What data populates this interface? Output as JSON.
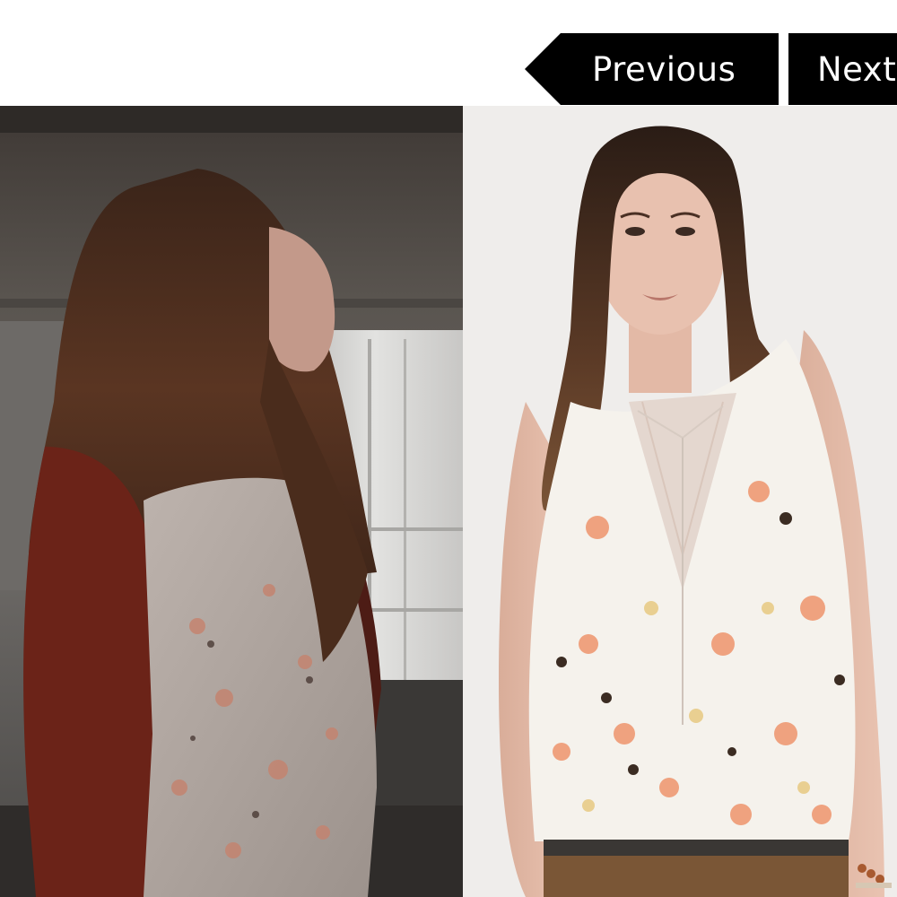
{
  "navigation": {
    "previous_label": "Previous",
    "next_label": "Next"
  },
  "photos": [
    {
      "name": "scene-still"
    },
    {
      "name": "product-photo"
    }
  ],
  "colors": {
    "button_background": "#000000",
    "button_text": "#ffffff",
    "page_background": "#ffffff"
  }
}
